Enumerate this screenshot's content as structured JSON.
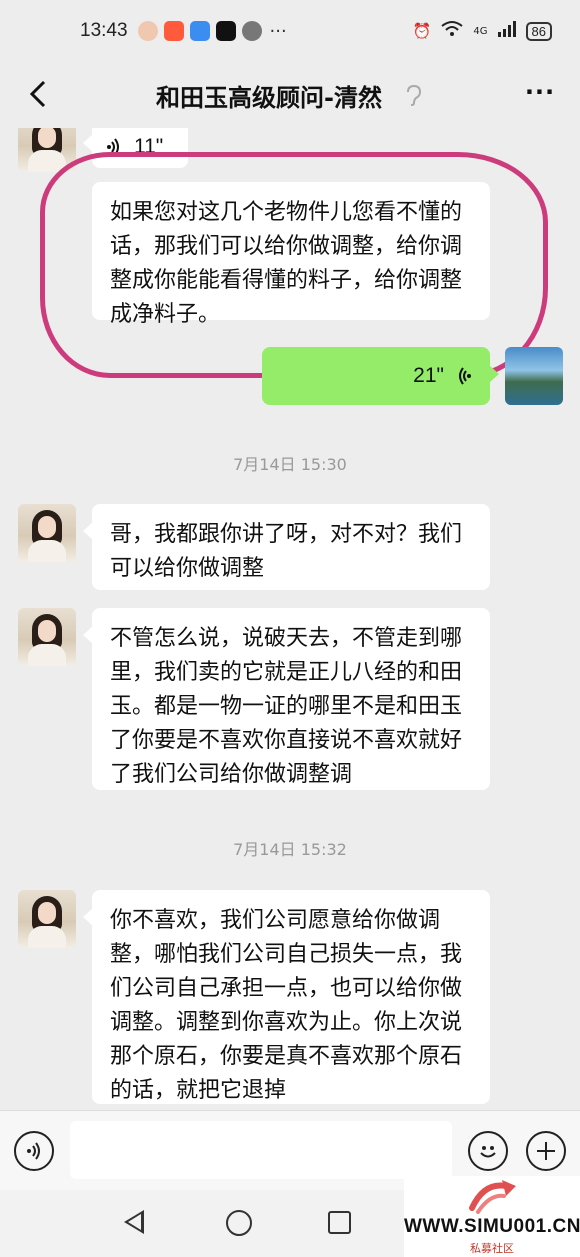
{
  "status_bar": {
    "time": "13:43",
    "network": "4G",
    "battery": "86",
    "more": "···"
  },
  "header": {
    "title": "和田玉高级顾问-清然",
    "back_icon": "chevron-left-icon",
    "more_label": "···"
  },
  "messages": {
    "voice_in": {
      "duration": "11\""
    },
    "text1": "如果您对这几个老物件儿您看不懂的话，那我们可以给你做调整，给你调整成你能能看得懂的料子，给你调整成净料子。",
    "voice_out": {
      "duration": "21\""
    },
    "time1": "7月14日 15:30",
    "text2": "哥，我都跟你讲了呀，对不对？我们可以给你做调整",
    "text3": "不管怎么说，说破天去，不管走到哪里，我们卖的它就是正儿八经的和田玉。都是一物一证的哪里不是和田玉了你要是不喜欢你直接说不喜欢就好了我们公司给你做调整调",
    "time2": "7月14日 15:32",
    "text4": "你不喜欢，我们公司愿意给你做调整，哪怕我们公司自己损失一点，我们公司自己承担一点，也可以给你做调整。调整到你喜欢为止。你上次说那个原石，你要是真不喜欢那个原石的话，就把它退掉"
  },
  "input_bar": {
    "placeholder": ""
  },
  "watermark": {
    "site": "WWW.SIMU001.CN",
    "sub": "私募社区"
  },
  "colors": {
    "my_bubble": "#95ec69",
    "highlight": "#cc3c7c"
  }
}
